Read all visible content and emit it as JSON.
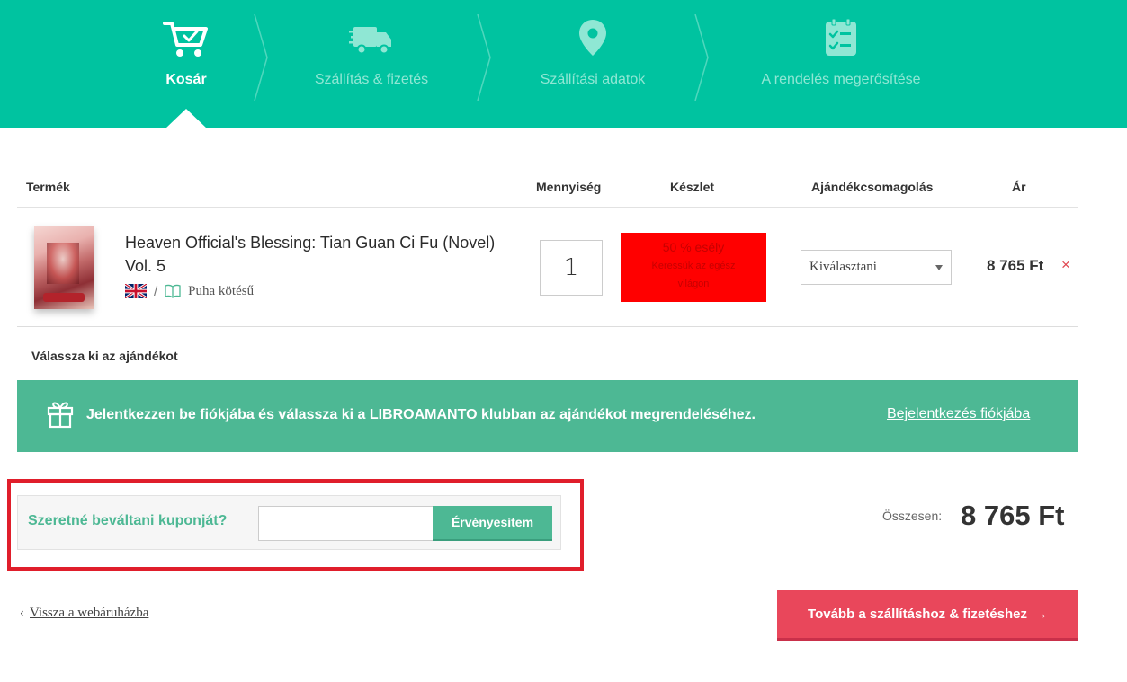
{
  "steps": [
    {
      "label": "Kosár",
      "icon": "cart-check-icon",
      "active": true
    },
    {
      "label": "Szállítás & fizetés",
      "icon": "truck-icon",
      "active": false
    },
    {
      "label": "Szállítási adatok",
      "icon": "map-pin-icon",
      "active": false
    },
    {
      "label": "A rendelés megerősítése",
      "icon": "clipboard-checklist-icon",
      "active": false
    }
  ],
  "table": {
    "headers": {
      "product": "Termék",
      "quantity": "Mennyiség",
      "stock": "Készlet",
      "gift_wrap": "Ajándékcsomagolás",
      "price": "Ár"
    }
  },
  "item": {
    "title": "Heaven Official's Blessing: Tian Guan Ci Fu (Novel) Vol. 5",
    "separator": "/",
    "binding": "Puha kötésű",
    "language_icon": "uk-flag-icon",
    "quantity": "1",
    "stock_main": "50 % esély",
    "stock_sub": "Keressük az egész világon",
    "gift_wrap_selected": "Kiválasztani",
    "price": "8 765 Ft",
    "remove_symbol": "×"
  },
  "gifts": {
    "heading": "Válassza ki az ajándékot",
    "banner_text": "Jelentkezzen be fiókjába és válassza ki a LIBROAMANTO klubban az ajándékot megrendeléséhez.",
    "banner_link": "Bejelentkezés fiókjába"
  },
  "coupon": {
    "label": "Szeretné beváltani kuponját?",
    "input_value": "",
    "button": "Érvényesítem"
  },
  "summary": {
    "total_label": "Összesen:",
    "total_value": "8 765 Ft"
  },
  "nav": {
    "back_arrow": "‹",
    "back_label": "Vissza a webáruházba",
    "continue_label": "Tovább a szállításhoz & fizetéshez",
    "continue_arrow": "→"
  },
  "colors": {
    "header_bg": "#00c3a0",
    "banner_bg": "#4db894",
    "stock_bg": "#ff0000",
    "continue_bg": "#e9475b",
    "coupon_highlight": "#e01e2b"
  }
}
